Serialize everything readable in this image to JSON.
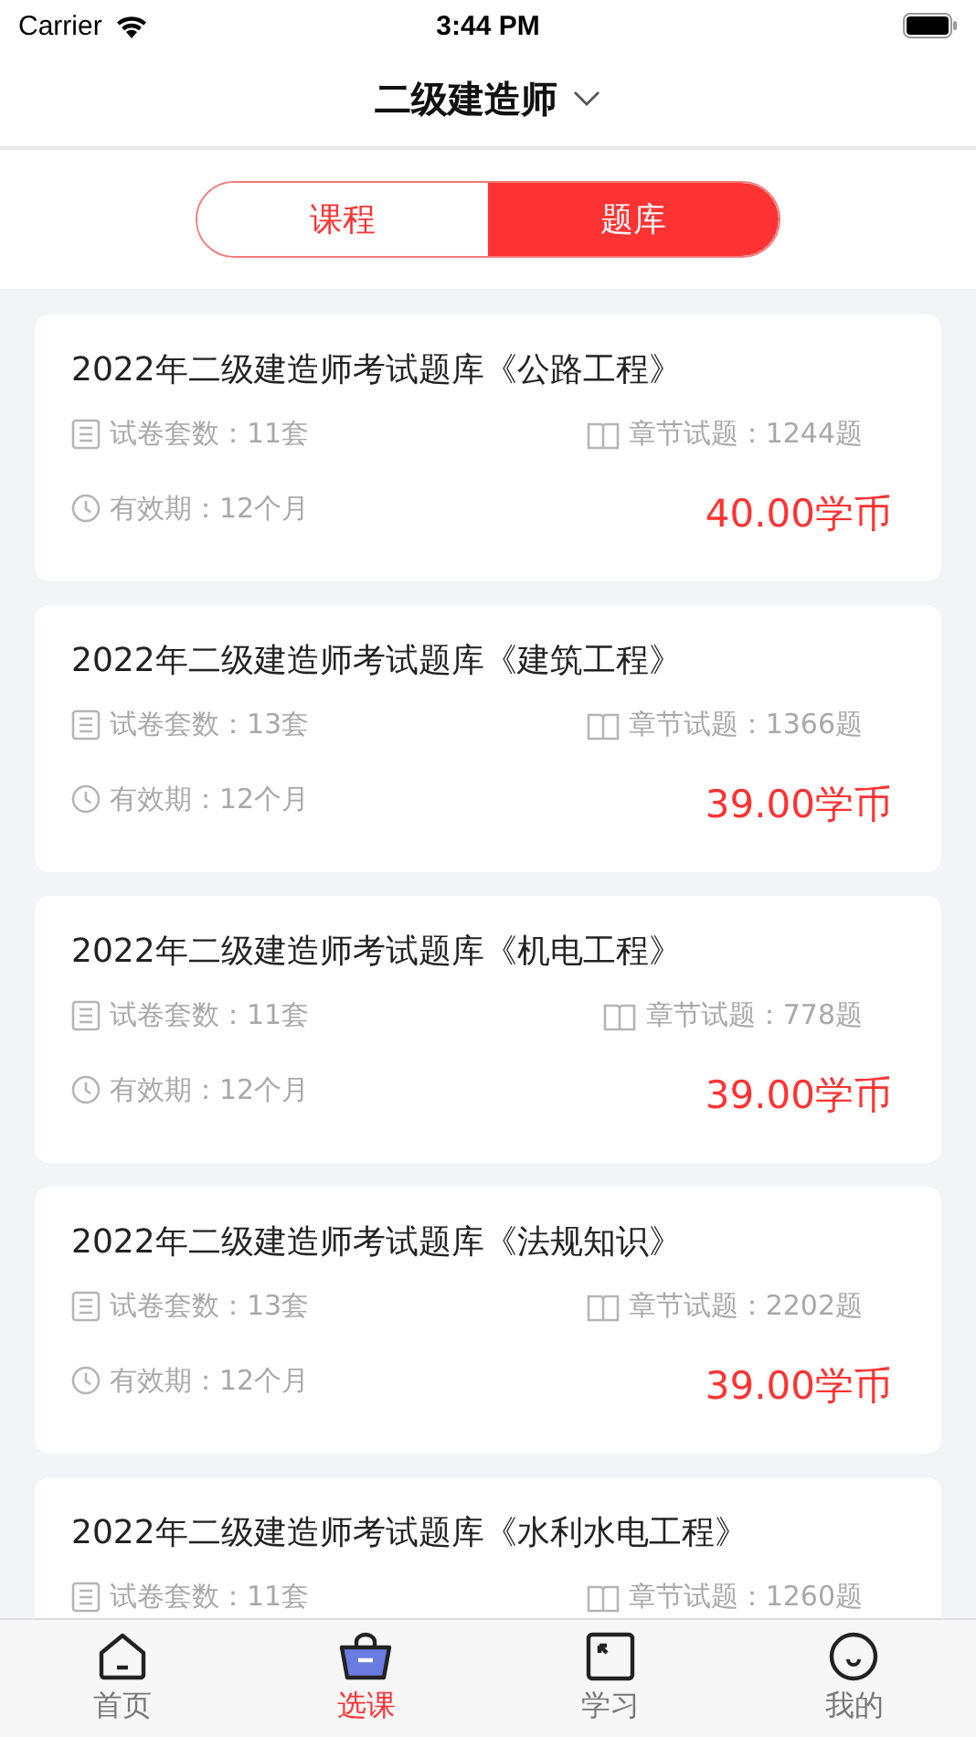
{
  "status_bar": {
    "carrier": "Carrier",
    "time": "3:44 PM"
  },
  "nav": {
    "title": "二级建造师"
  },
  "segments": [
    {
      "label": "课程",
      "selected": false
    },
    {
      "label": "题库",
      "selected": true
    }
  ],
  "cards": [
    {
      "title": "2022年二级建造师考试题库《公路工程》",
      "papers": "试卷套数：11套",
      "chapters": "章节试题：1244题",
      "validity": "有效期：12个月",
      "price": "40.00学币"
    },
    {
      "title": "2022年二级建造师考试题库《建筑工程》",
      "papers": "试卷套数：13套",
      "chapters": "章节试题：1366题",
      "validity": "有效期：12个月",
      "price": "39.00学币"
    },
    {
      "title": "2022年二级建造师考试题库《机电工程》",
      "papers": "试卷套数：11套",
      "chapters": "章节试题：778题",
      "validity": "有效期：12个月",
      "price": "39.00学币"
    },
    {
      "title": "2022年二级建造师考试题库《法规知识》",
      "papers": "试卷套数：13套",
      "chapters": "章节试题：2202题",
      "validity": "有效期：12个月",
      "price": "39.00学币"
    },
    {
      "title": "2022年二级建造师考试题库《水利水电工程》",
      "papers": "试卷套数：11套",
      "chapters": "章节试题：1260题"
    }
  ],
  "tab_bar": [
    {
      "kind": "home",
      "label": "首页",
      "selected": false
    },
    {
      "kind": "basket",
      "label": "选课",
      "selected": true
    },
    {
      "kind": "study",
      "label": "学习",
      "selected": false
    },
    {
      "kind": "me",
      "label": "我的",
      "selected": false
    }
  ]
}
